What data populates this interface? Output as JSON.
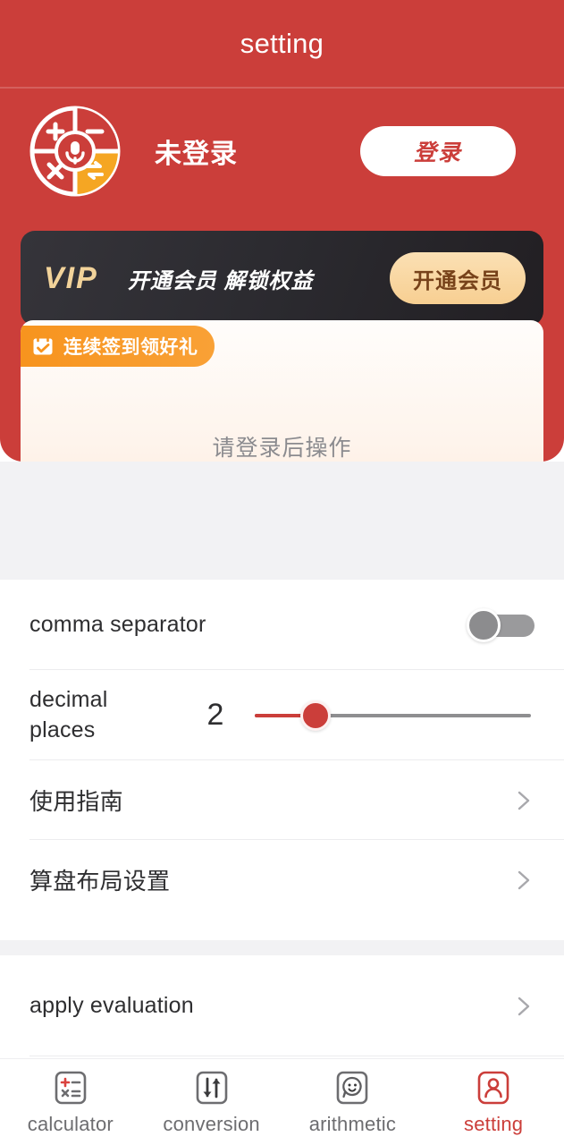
{
  "theme": {
    "brand_red": "#cb3e3a",
    "accent_orange": "#f7941e",
    "vip_gold": "#f2d39a",
    "page_gray": "#f2f2f4"
  },
  "header": {
    "title": "setting"
  },
  "profile": {
    "avatar_icon": "calculator-voice-logo",
    "name": "未登录",
    "login_label": "登录"
  },
  "vip_banner": {
    "tag": "VIP",
    "slogan": "开通会员  解锁权益",
    "cta_label": "开通会员"
  },
  "signin_card": {
    "badge_icon": "calendar-check-icon",
    "badge_label": "连续签到领好礼",
    "empty_text": "请登录后操作"
  },
  "settings": {
    "comma_separator": {
      "label": "comma separator",
      "toggle_state": "off"
    },
    "decimal_places": {
      "label": "decimal places",
      "value": "2",
      "fill_percent": "22"
    },
    "links": [
      {
        "label": "使用指南",
        "chevron_icon": "chevron-right-icon"
      },
      {
        "label": "算盘布局设置",
        "chevron_icon": "chevron-right-icon"
      }
    ],
    "apply_evaluation": {
      "label": "apply evaluation",
      "chevron_icon": "chevron-right-icon"
    }
  },
  "bottom_nav": {
    "items": [
      {
        "label": "calculator",
        "icon": "calculator-icon",
        "active": false
      },
      {
        "label": "conversion",
        "icon": "arrows-updown-icon",
        "active": false
      },
      {
        "label": "arithmetic",
        "icon": "chat-smiley-icon",
        "active": false
      },
      {
        "label": "setting",
        "icon": "user-profile-icon",
        "active": true
      }
    ]
  }
}
